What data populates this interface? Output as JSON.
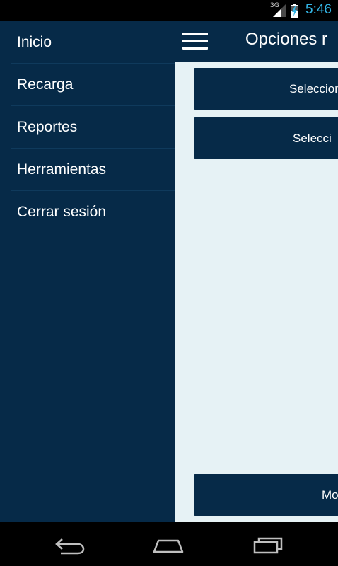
{
  "status_bar": {
    "network_type": "3G",
    "time": "5:46",
    "signal_icon": "signal-bars-icon",
    "battery_icon": "battery-charging-icon",
    "clock_color": "#33b5e5"
  },
  "action_bar": {
    "title": "Opciones r",
    "menu_icon": "hamburger-menu-icon"
  },
  "main": {
    "buttons": [
      {
        "label": "Seleccionar ti"
      },
      {
        "label": "Selecci"
      },
      {
        "label": "Mo"
      }
    ]
  },
  "drawer": {
    "items": [
      {
        "label": "Inicio"
      },
      {
        "label": "Recarga"
      },
      {
        "label": "Reportes"
      },
      {
        "label": "Herramientas"
      },
      {
        "label": "Cerrar sesión"
      }
    ]
  },
  "nav_bar": {
    "icons": [
      "back-icon",
      "home-icon",
      "recent-apps-icon"
    ]
  },
  "colors": {
    "primary": "#062a48",
    "background": "#e6f2f5",
    "text": "#ffffff"
  }
}
